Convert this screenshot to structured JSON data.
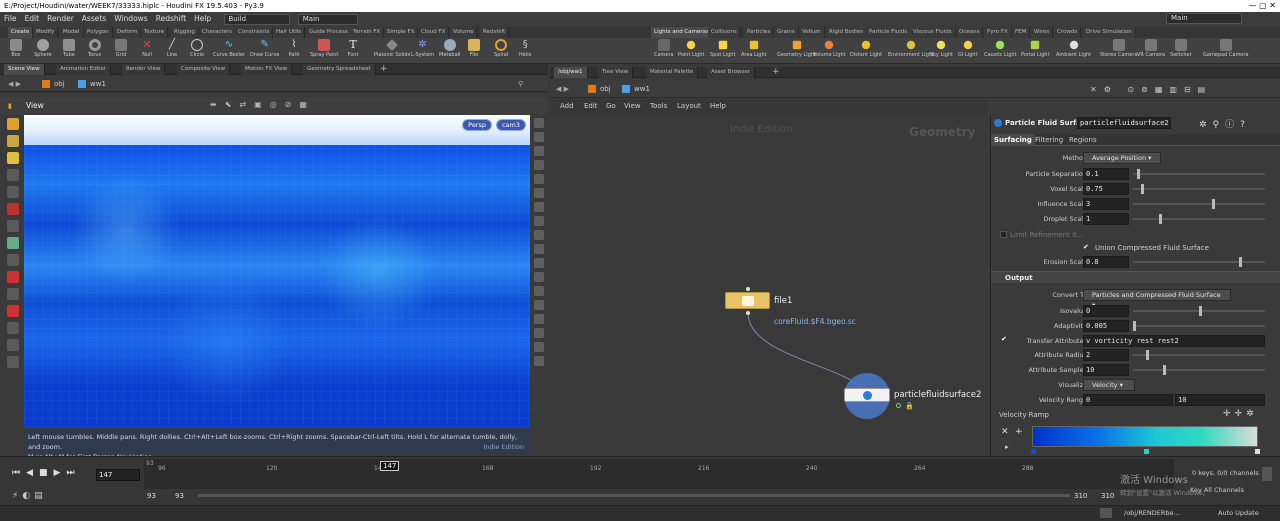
{
  "titlebar": {
    "text": "E:/Project/Houdini/water/WEEK7/33333.hiplc - Houdini FX 19.5.403 - Py3.9"
  },
  "menubar": {
    "items": [
      "File",
      "Edit",
      "Render",
      "Assets",
      "Windows",
      "Redshift",
      "Help"
    ],
    "desktop": "Build",
    "desktop2": "Main",
    "right_desktop": "Main"
  },
  "shelf_tabs_left": [
    "Create",
    "Modify",
    "Model",
    "Polygon",
    "Deform",
    "Texture",
    "Rigging",
    "Characters",
    "Constraints",
    "Hair Utils",
    "Guide Process",
    "Terrain FX",
    "Simple FX",
    "Cloud FX",
    "Volume",
    "Redshift"
  ],
  "shelf_tabs_right": [
    "Lights and Cameras",
    "Collisions",
    "Particles",
    "Grains",
    "Vellum",
    "Rigid Bodies",
    "Particle Fluids",
    "Viscous Fluids",
    "Oceans",
    "Pyro FX",
    "FEM",
    "Wires",
    "Crowds",
    "Drive Simulation"
  ],
  "tools_left": [
    "Box",
    "Sphere",
    "Tube",
    "Torus",
    "Grid",
    "Null",
    "Line",
    "Circle",
    "Curve Bezier",
    "Draw Curve",
    "Path",
    "Spray Paint",
    "Font",
    "Platonic Solids",
    "L-System",
    "Metaball",
    "File",
    "Spiral",
    "Helix"
  ],
  "tools_right": [
    "Camera",
    "Point Light",
    "Spot Light",
    "Area Light",
    "Geometry Light",
    "Volume Light",
    "Distant Light",
    "Environment Light",
    "Sky Light",
    "GI Light",
    "Caustic Light",
    "Portal Light",
    "Ambient Light",
    "Stereo Camera",
    "VR Camera",
    "Switcher",
    "Gamepad Camera"
  ],
  "left_panel": {
    "tabs": [
      "Scene View",
      "Animation Editor",
      "Render View",
      "Composite View",
      "Motion FX View",
      "Geometry Spreadsheet"
    ],
    "path": [
      "obj",
      "ww1"
    ],
    "view_label": "View",
    "persp": "Persp",
    "cam": "cam3",
    "hint": "Left mouse tumbles. Middle pans. Right dollies. Ctrl+Alt+Left box-zooms. Ctrl+Right zooms. Spacebar-Ctrl-Left tilts. Hold L for alternate tumble, dolly, and zoom.",
    "hint2": "M or Alt+M for First Person Navigation.",
    "edition": "Indie Edition"
  },
  "right_panel": {
    "tabs": [
      "/obj/ww1",
      "Tree View",
      "Material Palette",
      "Asset Browser"
    ],
    "path": [
      "obj",
      "ww1"
    ],
    "menu": [
      "Add",
      "Edit",
      "Go",
      "View",
      "Tools",
      "Layout",
      "Help"
    ],
    "edition": "Indie Edition",
    "context": "Geometry",
    "nodes": {
      "file": {
        "name": "file1",
        "detail": "coreFluid.$F4.bgeo.sc"
      },
      "pfs": {
        "name": "particlefluidsurface2"
      }
    }
  },
  "params": {
    "type": "Particle Fluid Surface",
    "node_name": "particlefluidsurface2",
    "tabs": [
      "Surfacing",
      "Filtering",
      "Regions"
    ],
    "method": {
      "label": "Method",
      "value": "Average Position"
    },
    "rows": [
      {
        "label": "Particle Separation",
        "value": "0.1",
        "slider": 0.03
      },
      {
        "label": "Voxel Scale",
        "value": "0.75",
        "slider": 0.06
      },
      {
        "label": "Influence Scale",
        "value": "3",
        "slider": 0.6
      },
      {
        "label": "Droplet Scale",
        "value": "1",
        "slider": 0.2
      }
    ],
    "refinement": "Limit Refinement It...",
    "union": "Union Compressed Fluid Surface",
    "erosion": {
      "label": "Erosion Scale",
      "value": "0.8",
      "slider": 0.8
    },
    "output_header": "Output",
    "convert": {
      "label": "Convert To",
      "value": "Particles and Compressed Fluid Surface"
    },
    "isovalue": {
      "label": "Isovalue",
      "value": "0",
      "slider": 0.5
    },
    "adaptivity": {
      "label": "Adaptivity",
      "value": "0.005",
      "slider": 0.0
    },
    "transfer": {
      "label": "Transfer Attributes",
      "value": "v vorticity rest rest2"
    },
    "radius": {
      "label": "Attribute Radius",
      "value": "2",
      "slider": 0.1
    },
    "samples": {
      "label": "Attribute Samples",
      "value": "10",
      "slider": 0.23
    },
    "visualize": {
      "label": "Visualize",
      "value": "Velocity"
    },
    "vrange": {
      "label": "Velocity Range",
      "min": "0",
      "max": "10"
    },
    "ramp": "Velocity Ramp"
  },
  "timeline": {
    "ticks": [
      "96",
      "120",
      "144",
      "168",
      "192",
      "216",
      "240",
      "264",
      "288"
    ],
    "current": "147",
    "frame_field": "147",
    "start_a": "93",
    "start_b": "93",
    "end_a": "310",
    "end_b": "310",
    "range_start_tick": "93",
    "keys": "0 keys, 0/0 channels",
    "key_all": "Key All Channels",
    "status_path": "/obj/RENDERbe...",
    "auto_update": "Auto Update",
    "win1": "激活 Windows",
    "win2": "转到\"设置\"以激活 Windows。"
  },
  "colors": {
    "accent": "#ffa826",
    "viewport_blue": "#1a5fe6",
    "node_yellow": "#e8c267",
    "node_blue": "#4a79c9"
  }
}
